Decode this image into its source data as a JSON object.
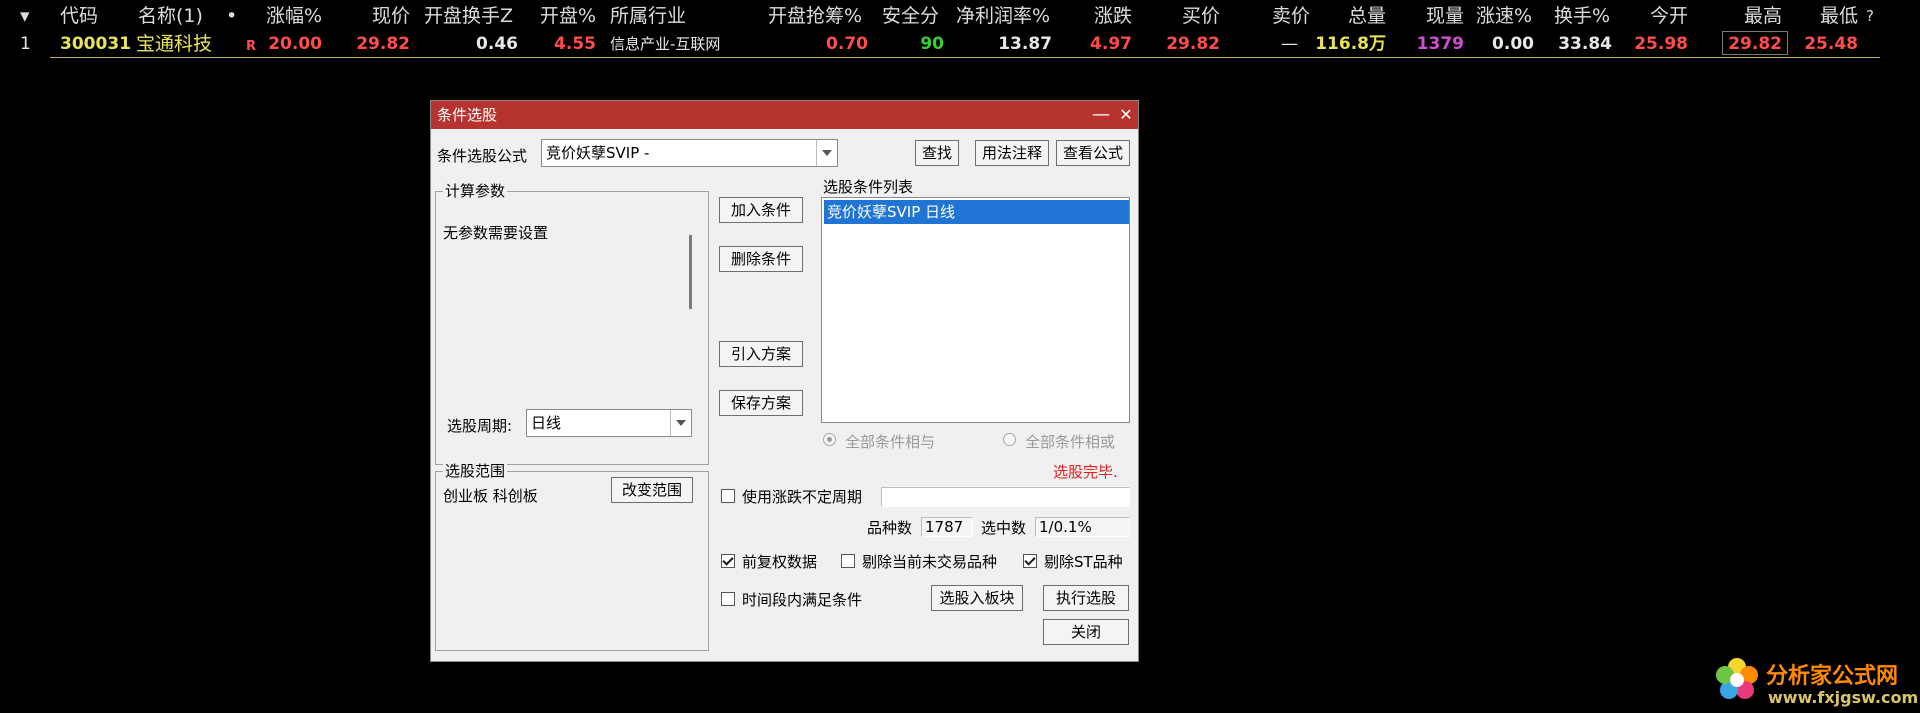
{
  "table": {
    "headers": [
      {
        "key": "sort",
        "label": "▾"
      },
      {
        "key": "code",
        "label": "代码"
      },
      {
        "key": "name",
        "label": "名称(1)"
      },
      {
        "key": "dot",
        "label": "•"
      },
      {
        "key": "chg_pct",
        "label": "涨幅%"
      },
      {
        "key": "price",
        "label": "现价"
      },
      {
        "key": "open_turnover",
        "label": "开盘换手Z"
      },
      {
        "key": "open_pct",
        "label": "开盘%"
      },
      {
        "key": "industry",
        "label": "所属行业"
      },
      {
        "key": "open_grab",
        "label": "开盘抢筹%"
      },
      {
        "key": "safety",
        "label": "安全分"
      },
      {
        "key": "net_margin",
        "label": "净利润率%"
      },
      {
        "key": "change",
        "label": "涨跌"
      },
      {
        "key": "bid",
        "label": "买价"
      },
      {
        "key": "ask",
        "label": "卖价"
      },
      {
        "key": "volume",
        "label": "总量"
      },
      {
        "key": "cur_vol",
        "label": "现量"
      },
      {
        "key": "speed",
        "label": "涨速%"
      },
      {
        "key": "turnover",
        "label": "换手%"
      },
      {
        "key": "today_open",
        "label": "今开"
      },
      {
        "key": "high",
        "label": "最高"
      },
      {
        "key": "low",
        "label": "最低"
      },
      {
        "key": "help",
        "label": "?"
      }
    ],
    "row": {
      "index": "1",
      "code": "300031",
      "name": "宝通科技",
      "flag": "R",
      "chg_pct": "20.00",
      "price": "29.82",
      "open_turnover": "0.46",
      "open_pct": "4.55",
      "industry": "信息产业-互联网",
      "open_grab": "0.70",
      "safety": "90",
      "net_margin": "13.87",
      "change": "4.97",
      "bid": "29.82",
      "ask": "—",
      "volume": "116.8万",
      "cur_vol": "1379",
      "speed": "0.00",
      "turnover": "33.84",
      "today_open": "25.98",
      "high": "29.82",
      "low": "25.48"
    }
  },
  "colors": {
    "red": "#ff4d4d",
    "green": "#36d13a",
    "yellow": "#e8e35a",
    "white": "#e8e8e8",
    "magenta": "#d04fd4",
    "title_bar": "#b7332f",
    "selection": "#1f74d4",
    "status_red": "#e0201e"
  },
  "dialog": {
    "title": "条件选股",
    "minimize": "—",
    "close": "✕",
    "formula_label": "条件选股公式",
    "formula_value": "竞价妖孽SVIP  -",
    "find_btn": "查找",
    "usage_btn": "用法注释",
    "view_formula_btn": "查看公式",
    "params_group": "计算参数",
    "no_params": "无参数需要设置",
    "period_label": "选股周期:",
    "period_value": "日线",
    "add_btn": "加入条件",
    "del_btn": "删除条件",
    "import_btn": "引入方案",
    "save_btn": "保存方案",
    "list_label": "选股条件列表",
    "list_items": [
      "竞价妖孽SVIP  日线"
    ],
    "radio_and": "全部条件相与",
    "radio_or": "全部条件相或",
    "status": "选股完毕.",
    "range_group": "选股范围",
    "range_value": "创业板 科创板",
    "change_range_btn": "改变范围",
    "uncertain_period": "使用涨跌不定周期",
    "count_label": "品种数",
    "count_value": "1787",
    "selected_label": "选中数",
    "selected_value": "1/0.1%",
    "chk_forward": "前复权数据",
    "chk_exclude_untraded": "剔除当前未交易品种",
    "chk_exclude_st": "剔除ST品种",
    "chk_time_range": "时间段内满足条件",
    "to_block_btn": "选股入板块",
    "execute_btn": "执行选股",
    "close_btn": "关闭"
  },
  "watermark": {
    "name": "分析家公式网",
    "url": "www.fxjgsw.com"
  }
}
